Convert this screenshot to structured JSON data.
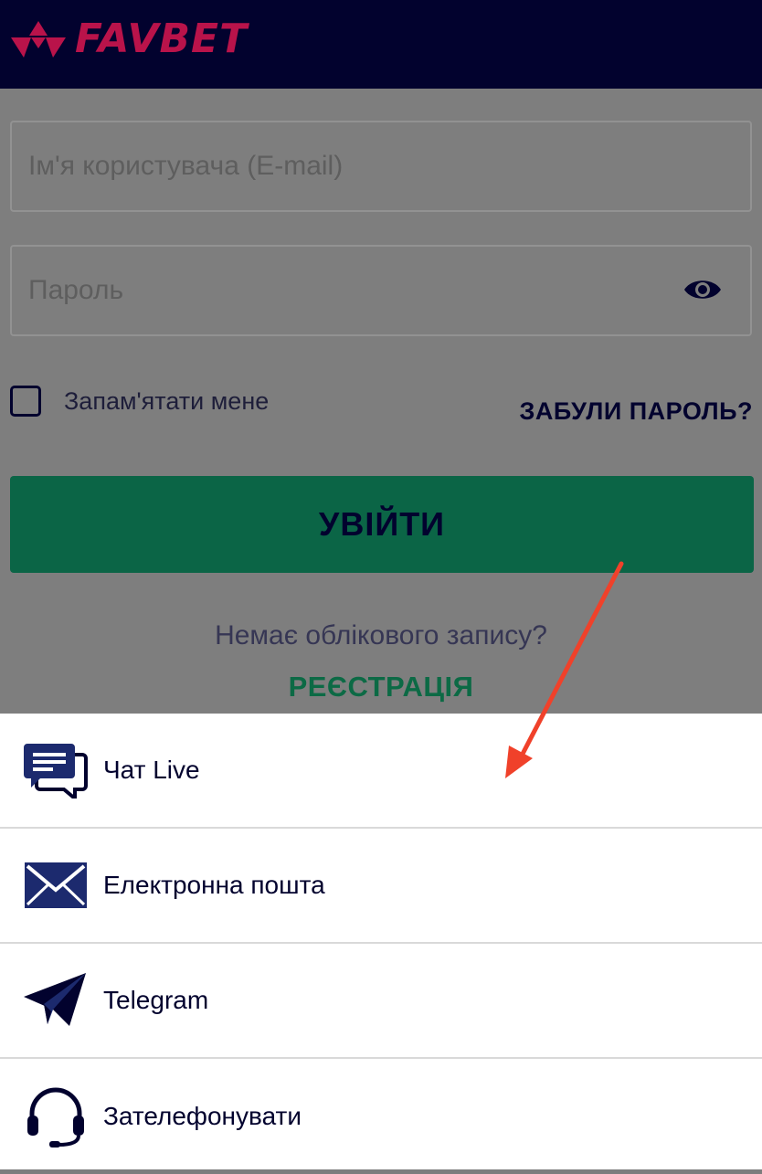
{
  "header": {
    "brand": "FAVBET",
    "brand_color": "#b9134a",
    "background": "#02022e"
  },
  "login_form": {
    "username_placeholder": "Ім'я користувача (E-mail)",
    "password_placeholder": "Пароль",
    "password_toggle_icon": "eye-icon",
    "remember_label": "Запам'ятати мене",
    "remember_checked": false,
    "forgot_password_link": "ЗАБУЛИ ПАРОЛЬ?",
    "login_button": "УВІЙТИ",
    "login_button_color": "#0b6546",
    "no_account_text": "Немає облікового запису?",
    "register_link": "РЕЄСТРАЦІЯ"
  },
  "contact_sheet": {
    "items": [
      {
        "label": "Чат Live",
        "icon": "chat-icon"
      },
      {
        "label": "Електронна пошта",
        "icon": "envelope-icon"
      },
      {
        "label": "Telegram",
        "icon": "telegram-icon"
      },
      {
        "label": "Зателефонувати",
        "icon": "headset-icon"
      }
    ]
  },
  "annotation": {
    "type": "arrow",
    "color": "#f0412a",
    "points_to": "Чат Live"
  }
}
